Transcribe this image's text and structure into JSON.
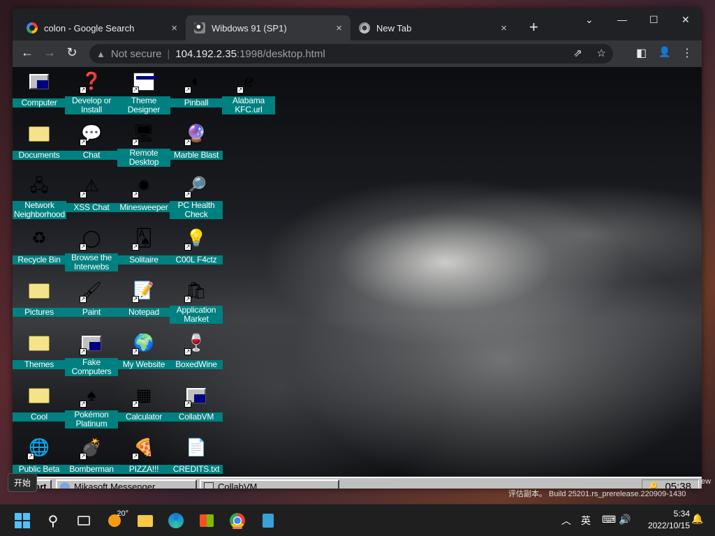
{
  "browser": {
    "tabs": [
      {
        "title": "colon - Google Search",
        "close": "×",
        "active": false,
        "favicon": "google-icon"
      },
      {
        "title": "Wibdows 91 (SP1)",
        "close": "×",
        "active": true,
        "favicon": "wibdows-icon"
      },
      {
        "title": "New Tab",
        "close": "×",
        "active": false,
        "favicon": "chrome-icon"
      }
    ],
    "new_tab": "+",
    "window_controls": {
      "tab_search": "⌄",
      "minimize": "—",
      "maximize": "☐",
      "close": "✕"
    },
    "nav": {
      "back": "←",
      "forward": "→",
      "reload": "↻"
    },
    "omnibox": {
      "warning_icon": "▲",
      "security": "Not secure",
      "separator": "|",
      "host": "104.192.2.35",
      "path": ":1998/desktop.html"
    },
    "omnibox_actions": {
      "share": "⇗",
      "bookmark": "☆"
    },
    "toolbar_actions": {
      "side_panel": "◧",
      "profile": "👤",
      "menu": "⋮"
    }
  },
  "desktop": {
    "icons": [
      {
        "label": "Computer",
        "glyph": "pc",
        "shortcut": false
      },
      {
        "label": "Develop or Install",
        "glyph": "❓",
        "shortcut": true
      },
      {
        "label": "Theme Designer",
        "glyph": "win",
        "shortcut": true
      },
      {
        "label": "Pinball",
        "glyph": "◐",
        "shortcut": true
      },
      {
        "label": "Alabama KFC.url",
        "glyph": "ℯ",
        "shortcut": true
      },
      {
        "label": "Documents",
        "glyph": "folder",
        "shortcut": false
      },
      {
        "label": "Chat",
        "glyph": "💬",
        "shortcut": true
      },
      {
        "label": "Remote Desktop",
        "glyph": "🖥",
        "shortcut": true
      },
      {
        "label": "Marble Blast",
        "glyph": "🔮",
        "shortcut": true
      },
      {
        "label": "Network Neighborhood",
        "glyph": "🖧",
        "shortcut": false
      },
      {
        "label": "XSS Chat",
        "glyph": "⚠",
        "shortcut": true
      },
      {
        "label": "Minesweeper",
        "glyph": "✹",
        "shortcut": true
      },
      {
        "label": "PC Health Check",
        "glyph": "🔎",
        "shortcut": true
      },
      {
        "label": "Recycle Bin",
        "glyph": "♻",
        "shortcut": false
      },
      {
        "label": "Browse the Interwebs",
        "glyph": "◯",
        "shortcut": true
      },
      {
        "label": "Solitaire",
        "glyph": "🂡",
        "shortcut": true
      },
      {
        "label": "C00L F4ctz",
        "glyph": "💡",
        "shortcut": true
      },
      {
        "label": "Pictures",
        "glyph": "folder",
        "shortcut": false
      },
      {
        "label": "Paint",
        "glyph": "🖌",
        "shortcut": true
      },
      {
        "label": "Notepad",
        "glyph": "📝",
        "shortcut": true
      },
      {
        "label": "Application Market",
        "glyph": "🛍",
        "shortcut": true
      },
      {
        "label": "Themes",
        "glyph": "folder",
        "shortcut": false
      },
      {
        "label": "Fake Computers",
        "glyph": "pc",
        "shortcut": true
      },
      {
        "label": "My Website",
        "glyph": "🌍",
        "shortcut": true
      },
      {
        "label": "BoxedWine",
        "glyph": "🍷",
        "shortcut": true
      },
      {
        "label": "Cool",
        "glyph": "folder",
        "shortcut": false
      },
      {
        "label": "Pokémon Platinum",
        "glyph": "♠",
        "shortcut": true
      },
      {
        "label": "Calculator",
        "glyph": "▦",
        "shortcut": true
      },
      {
        "label": "CollabVM",
        "glyph": "pc",
        "shortcut": true
      },
      {
        "label": "Public Beta",
        "glyph": "🌐",
        "shortcut": true
      },
      {
        "label": "Bomberman",
        "glyph": "💣",
        "shortcut": true
      },
      {
        "label": "PIZZA!!!",
        "glyph": "🍕",
        "shortcut": true
      },
      {
        "label": "CREDITS.txt",
        "glyph": "📄",
        "shortcut": false
      }
    ],
    "taskbar": {
      "start_label": "art",
      "tasks": [
        {
          "label": "Mikasoft Messenger"
        },
        {
          "label": "CollabVM"
        }
      ],
      "clock": "05:38",
      "tray_icon": "🔑"
    }
  },
  "overlay": {
    "tooltip": "开始",
    "eval_text": "评估副本。 Build 25201.rs_prerelease.220909-1430",
    "eval_right": "ew"
  },
  "windows_taskbar": {
    "weather_temp": "20°",
    "tray": {
      "chevron": "︿",
      "ime": "英",
      "network": "⌨",
      "volume": "🔊"
    },
    "time": "5:34",
    "date": "2022/10/15",
    "notification": "🔔"
  },
  "colors": {
    "desktop_label_bg": "#008080",
    "chrome_bg": "#202124",
    "win95_gray": "#c0c0c0"
  }
}
